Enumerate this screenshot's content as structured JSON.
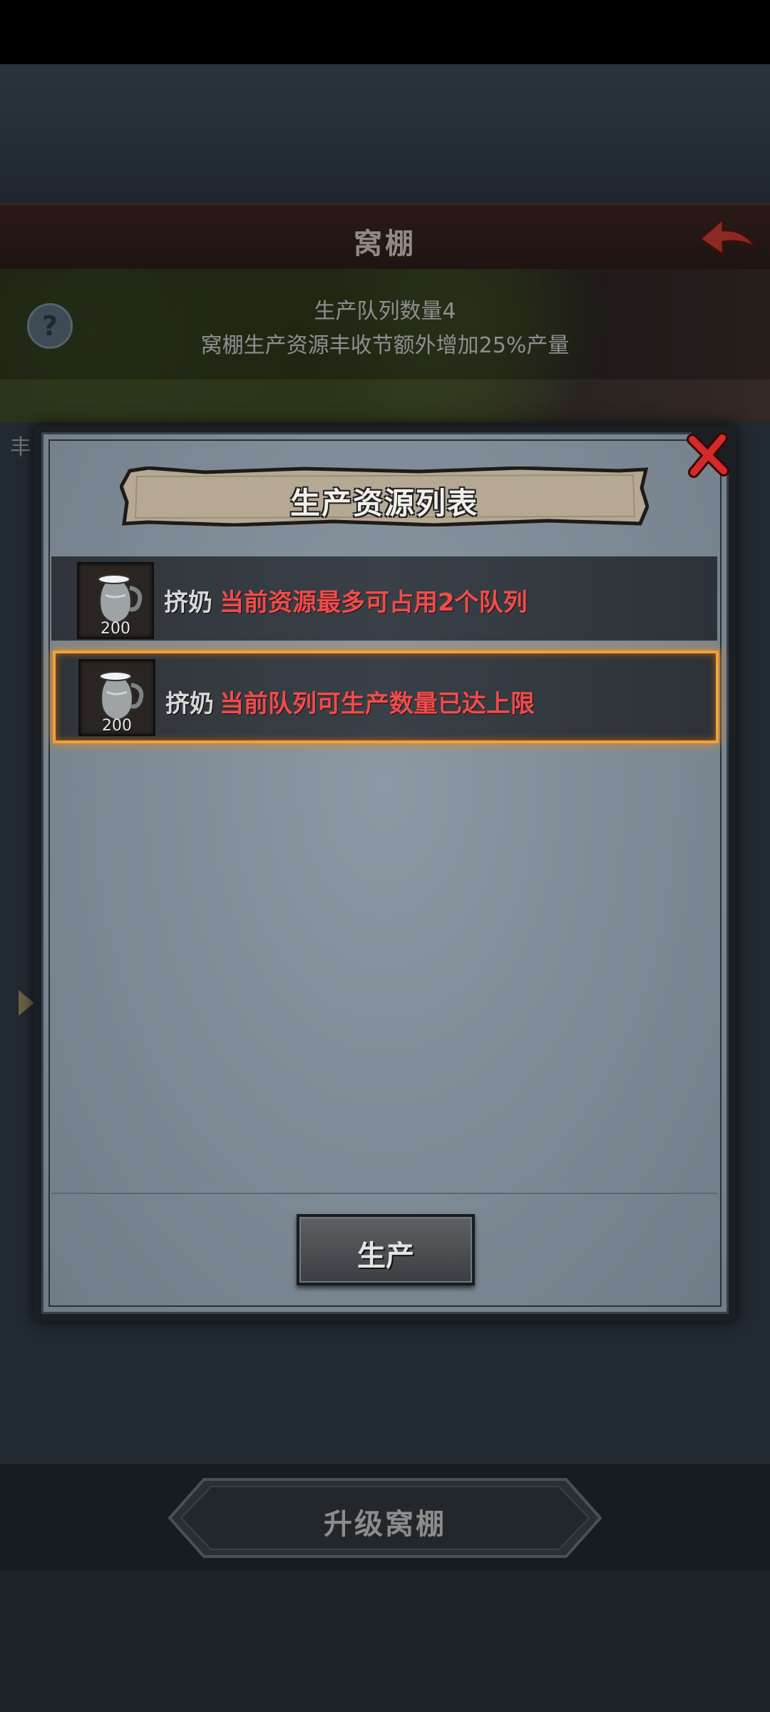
{
  "building": {
    "title": "窝棚",
    "info_line1": "生产队列数量4",
    "info_line2": "窝棚生产资源丰收节额外增加25%产量",
    "side_label": "丰",
    "upgrade_label": "升级窝棚"
  },
  "modal": {
    "title": "生产资源列表",
    "items": [
      {
        "name": "挤奶",
        "count": "200",
        "message": "当前资源最多可占用2个队列",
        "icon": "milk-jug-icon",
        "selected": false
      },
      {
        "name": "挤奶",
        "count": "200",
        "message": "当前队列可生产数量已达上限",
        "icon": "milk-jug-icon",
        "selected": true
      }
    ],
    "produce_label": "生产"
  },
  "colors": {
    "warning_text": "#ee4c4c",
    "selection_glow": "#f0a238",
    "close_red": "#d42a2a",
    "back_arrow": "#8a2a22"
  }
}
